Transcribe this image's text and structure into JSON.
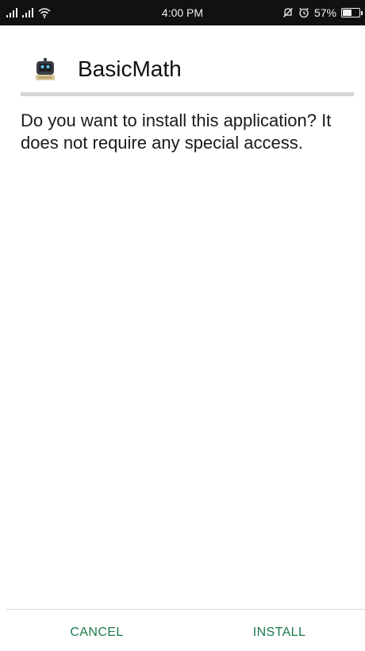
{
  "status_bar": {
    "time": "4:00 PM",
    "battery_percent": "57%",
    "battery_level": 0.57,
    "icons": [
      "signal-icon",
      "signal-icon",
      "wifi-icon",
      "mute-icon",
      "alarm-icon",
      "battery-icon"
    ]
  },
  "app": {
    "name": "BasicMath",
    "icon": "robot-app-icon"
  },
  "dialog": {
    "message": "Do you want to install this application? It does not require any special access."
  },
  "actions": {
    "cancel_label": "CANCEL",
    "install_label": "INSTALL"
  },
  "colors": {
    "accent": "#1b7a4a",
    "status_bar": "#111111",
    "divider": "#d6d6d6"
  }
}
